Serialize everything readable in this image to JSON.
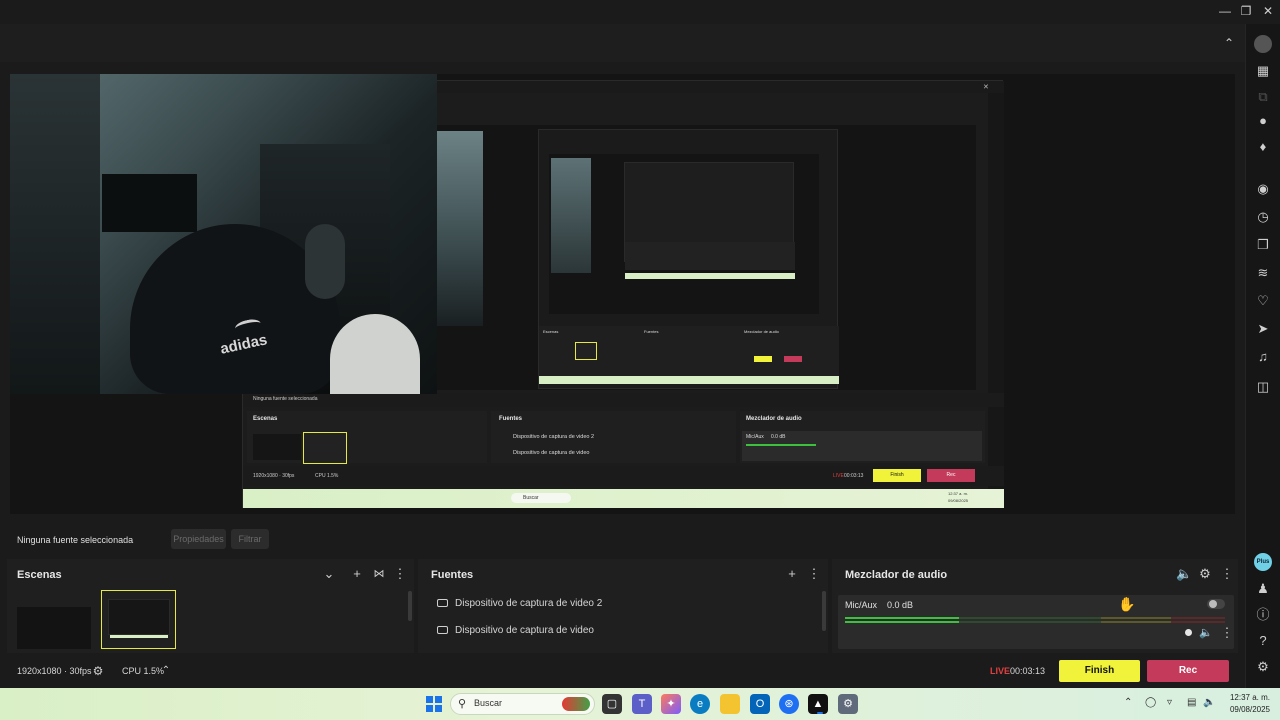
{
  "status": {
    "no_source": "Ninguna fuente seleccionada",
    "properties": "Propiedades",
    "filters": "Filtrar"
  },
  "scenes": {
    "title": "Escenas"
  },
  "sources": {
    "title": "Fuentes",
    "items": [
      "Dispositivo de captura de video 2",
      "Dispositivo de captura de video"
    ]
  },
  "mixer": {
    "title": "Mezclador de audio",
    "channel_name": "Mic/Aux",
    "channel_level": "0.0 dB"
  },
  "footer": {
    "resolution": "1920x1080 · 30fps",
    "cpu": "CPU 1.5%",
    "live_label": "LIVE",
    "timer": "00:03:13",
    "finish": "Finish",
    "rec": "Rec"
  },
  "sidebar": {
    "plus_badge": "Plus"
  },
  "taskbar": {
    "search_placeholder": "Buscar",
    "time": "12:37 a. m.",
    "date": "09/08/2025"
  },
  "webcam": {
    "logo_text": "adidas"
  },
  "nested": {
    "no_source": "Ninguna fuente seleccionada",
    "scenes": "Escenas",
    "sources": "Fuentes",
    "mixer": "Mezclador de audio",
    "src1": "Dispositivo de captura de video 2",
    "src2": "Dispositivo de captura de video",
    "mic": "Mic/Aux",
    "db": "0.0 dB",
    "res": "1920x1080 · 30fps",
    "cpu": "CPU 1.5%",
    "live": "LIVE",
    "timer": "00:03:13",
    "finish": "Finish",
    "rec": "Rec",
    "search": "Buscar",
    "time": "12:37 a. m.",
    "date": "09/08/2025"
  },
  "colors": {
    "accent_yellow": "#f0f33a",
    "rec_red": "#c33a5a",
    "meter_green": "#3fbf3f"
  }
}
